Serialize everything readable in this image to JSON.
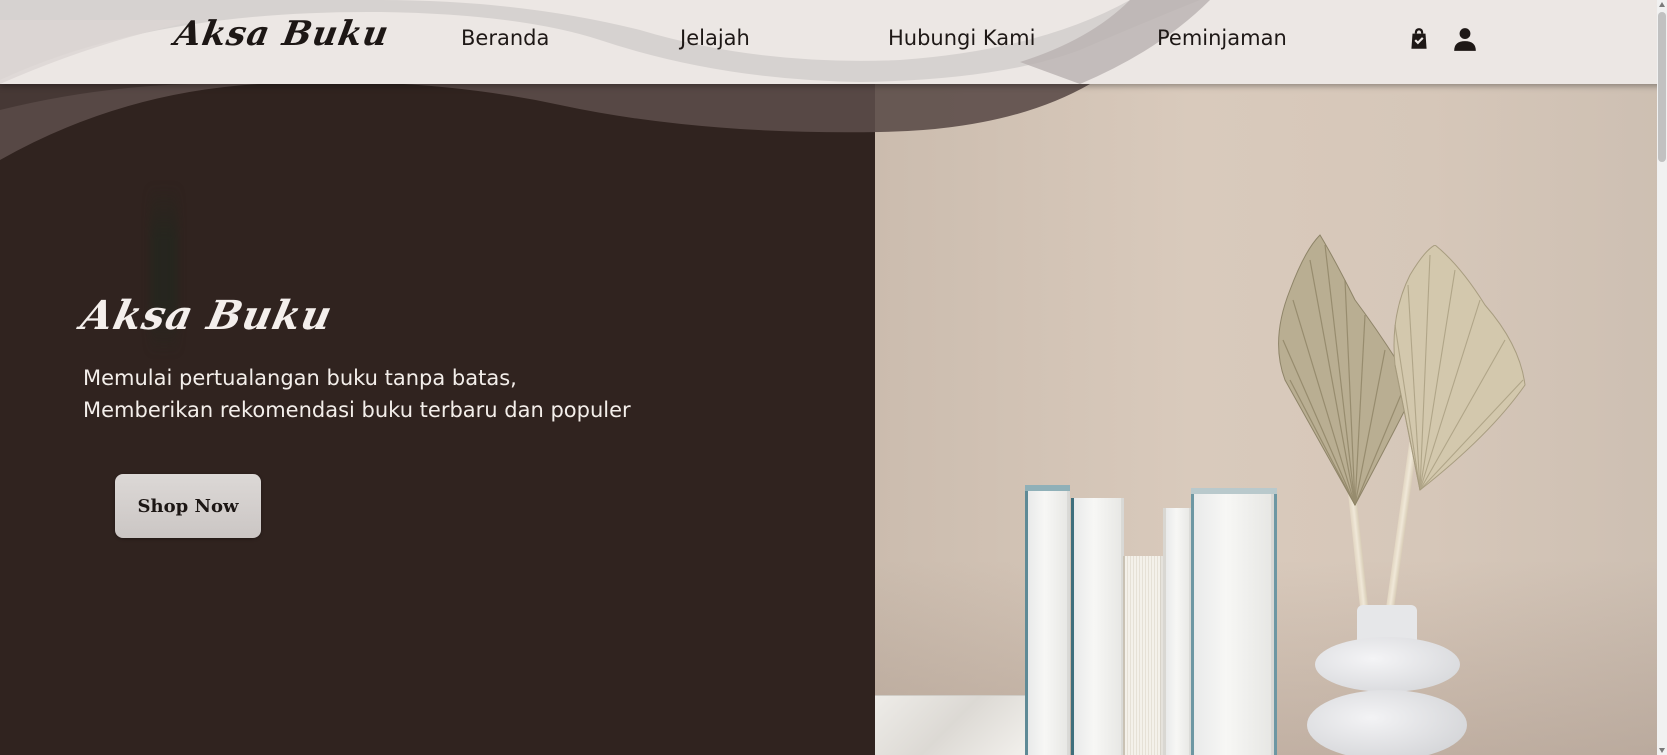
{
  "navbar": {
    "brand": "Aksa Buku",
    "links": [
      {
        "label": "Beranda"
      },
      {
        "label": "Jelajah"
      },
      {
        "label": "Hubungi Kami"
      },
      {
        "label": "Peminjaman"
      }
    ],
    "icons": [
      "shopping-bag-icon",
      "user-icon"
    ]
  },
  "hero": {
    "title": "Aksa Buku",
    "subtitle_line1": "Memulai pertualangan buku tanpa batas,",
    "subtitle_line2": "Memberikan rekomendasi buku terbaru dan populer",
    "cta_label": "Shop Now"
  },
  "colors": {
    "nav_bg": "#ece7e4",
    "hero_dark": "#30231f",
    "photo_bg": "#d6c7b9",
    "button_bg": "#d3cfcd"
  }
}
